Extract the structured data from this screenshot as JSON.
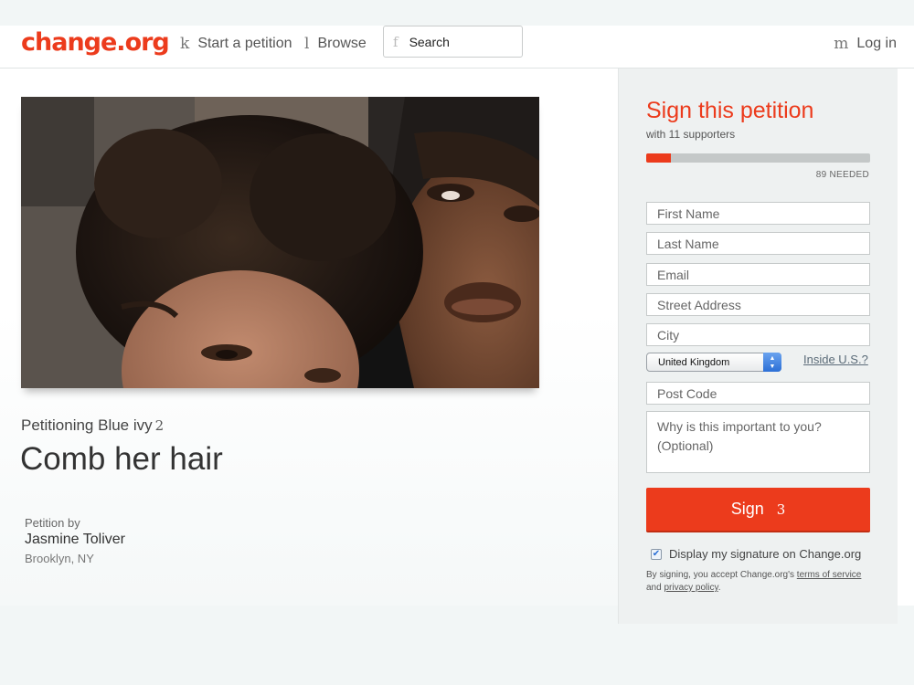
{
  "header": {
    "logo": "change.org",
    "nav": [
      {
        "glyph": "k",
        "label": "Start a petition"
      },
      {
        "glyph": "l",
        "label": "Browse"
      }
    ],
    "search": {
      "glyph": "f",
      "placeholder": "Search"
    },
    "login": {
      "glyph": "m",
      "label": "Log in"
    }
  },
  "petition": {
    "petitioning_label": "Petitioning Blue ivy",
    "petitioning_glyph": "2",
    "title": "Comb her hair",
    "petition_by_label": "Petition by",
    "author": "Jasmine Toliver",
    "location": "Brooklyn, NY"
  },
  "sign_form": {
    "heading": "Sign this petition",
    "supporters": "with 11 supporters",
    "progress_fraction": 0.11,
    "needed": "89 NEEDED",
    "fields": {
      "first_name": "First Name",
      "last_name": "Last Name",
      "email": "Email",
      "street": "Street Address",
      "city": "City",
      "post_code": "Post Code",
      "reason": "Why is this important to you? (Optional)"
    },
    "country_selected": "United Kingdom",
    "inside_us_link": "Inside U.S.?",
    "sign_button": "Sign",
    "sign_glyph": "3",
    "display_signature_label": "Display my signature on Change.org",
    "display_signature_checked": true,
    "legal_prefix": "By signing, you accept Change.org's",
    "terms_link": "terms of service",
    "legal_and": "and",
    "privacy_link": "privacy policy",
    "legal_suffix": "."
  },
  "colors": {
    "brand": "#ec3b1c",
    "sidebar_bg": "#eef1f1",
    "page_bg": "#f2f6f6"
  }
}
